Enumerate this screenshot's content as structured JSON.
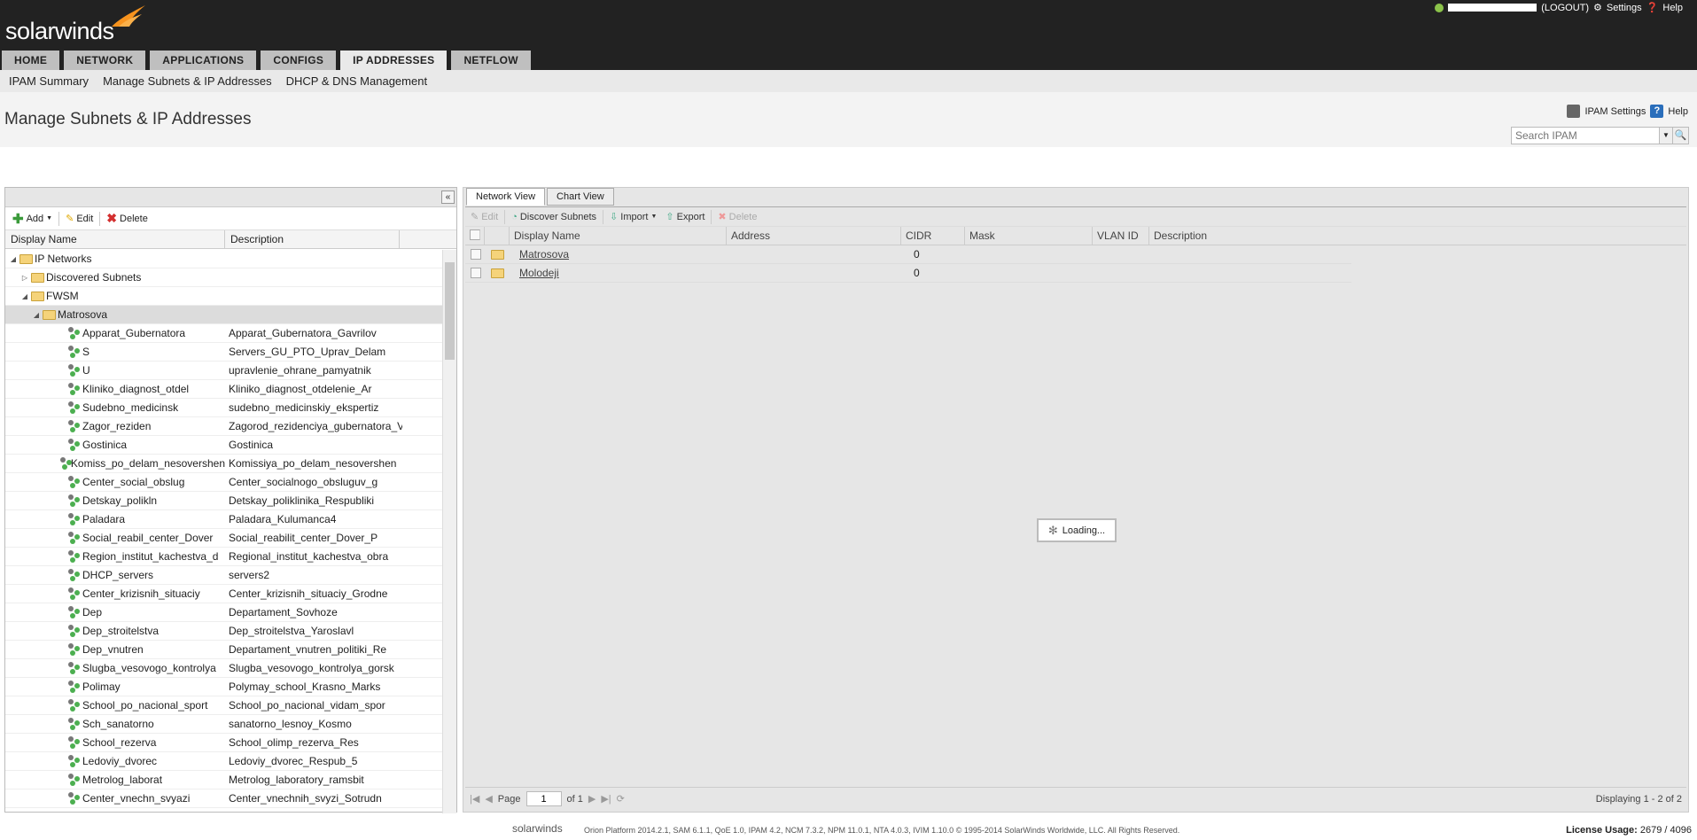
{
  "header": {
    "logo": "solarwinds",
    "logout": "(LOGOUT)",
    "settings": "Settings",
    "help": "Help",
    "colors": {
      "bg": "#222222",
      "flame": "#f7931e"
    }
  },
  "nav": {
    "tabs": [
      "HOME",
      "NETWORK",
      "APPLICATIONS",
      "CONFIGS",
      "IP ADDRESSES",
      "NETFLOW"
    ],
    "active": "IP ADDRESSES"
  },
  "subnav": [
    "IPAM Summary",
    "Manage Subnets & IP Addresses",
    "DHCP & DNS Management"
  ],
  "page": {
    "title": "Manage Subnets & IP Addresses",
    "ipam_settings": "IPAM Settings",
    "help": "Help",
    "search_placeholder": "Search IPAM"
  },
  "left": {
    "toolbar": {
      "add": "Add",
      "edit": "Edit",
      "delete": "Delete"
    },
    "columns": [
      "Display Name",
      "Description"
    ],
    "tree": [
      {
        "level": 0,
        "type": "folder",
        "name": "IP Networks",
        "desc": "",
        "expanded": true
      },
      {
        "level": 1,
        "type": "folder",
        "name": "Discovered Subnets",
        "desc": "",
        "expanded": false
      },
      {
        "level": 1,
        "type": "folder",
        "name": "FWSM",
        "desc": "",
        "expanded": true
      },
      {
        "level": 2,
        "type": "folder",
        "name": "Matrosova",
        "desc": "",
        "expanded": true,
        "selected": true
      },
      {
        "level": 3,
        "type": "subnet",
        "name": "Apparat_Gubernatora",
        "desc": "Apparat_Gubernatora_Gavrilov"
      },
      {
        "level": 3,
        "type": "subnet",
        "name": "S",
        "desc": "Servers_GU_PTO_Uprav_Delam"
      },
      {
        "level": 3,
        "type": "subnet",
        "name": "U",
        "desc": "upravlenie_ohrane_pamyatnik"
      },
      {
        "level": 3,
        "type": "subnet",
        "name": "Kliniko_diagnost_otdel",
        "desc": "Kliniko_diagnost_otdelenie_Ar"
      },
      {
        "level": 3,
        "type": "subnet",
        "name": "Sudebno_medicinsk",
        "desc": "sudebno_medicinskiy_ekspertiz"
      },
      {
        "level": 3,
        "type": "subnet",
        "name": "Zagor_reziden",
        "desc": "Zagorod_rezidenciya_gubernatora_V"
      },
      {
        "level": 3,
        "type": "subnet",
        "name": "Gostinica",
        "desc": "Gostinica"
      },
      {
        "level": 3,
        "type": "subnet",
        "name": "Komiss_po_delam_nesovershen",
        "desc": "Komissiya_po_delam_nesovershen"
      },
      {
        "level": 3,
        "type": "subnet",
        "name": "Center_social_obslug",
        "desc": "Center_socialnogo_obsluguv_g"
      },
      {
        "level": 3,
        "type": "subnet",
        "name": "Detskay_polikln",
        "desc": "Detskay_poliklinika_Respubliki"
      },
      {
        "level": 3,
        "type": "subnet",
        "name": "Paladara",
        "desc": "Paladara_Kulumanca4"
      },
      {
        "level": 3,
        "type": "subnet",
        "name": "Social_reabil_center_Dover",
        "desc": "Social_reabilit_center_Dover_P"
      },
      {
        "level": 3,
        "type": "subnet",
        "name": "Region_institut_kachestva_d",
        "desc": "Regional_institut_kachestva_obra"
      },
      {
        "level": 3,
        "type": "subnet",
        "name": "DHCP_servers",
        "desc": "servers2"
      },
      {
        "level": 3,
        "type": "subnet",
        "name": "Center_krizisnih_situaciy",
        "desc": "Center_krizisnih_situaciy_Grodne"
      },
      {
        "level": 3,
        "type": "subnet",
        "name": "Dep",
        "desc": "Departament_Sovhoze"
      },
      {
        "level": 3,
        "type": "subnet",
        "name": "Dep_stroitelstva",
        "desc": "Dep_stroitelstva_Yaroslavl"
      },
      {
        "level": 3,
        "type": "subnet",
        "name": "Dep_vnutren",
        "desc": "Departament_vnutren_politiki_Re"
      },
      {
        "level": 3,
        "type": "subnet",
        "name": "Slugba_vesovogo_kontrolya",
        "desc": "Slugba_vesovogo_kontrolya_gorsk"
      },
      {
        "level": 3,
        "type": "subnet",
        "name": "Polimay",
        "desc": "Polymay_school_Krasno_Marks"
      },
      {
        "level": 3,
        "type": "subnet",
        "name": "School_po_nacional_sport",
        "desc": "School_po_nacional_vidam_spor"
      },
      {
        "level": 3,
        "type": "subnet",
        "name": "Sch_sanatorno",
        "desc": "sanatorno_lesnoy_Kosmo"
      },
      {
        "level": 3,
        "type": "subnet",
        "name": "School_rezerva",
        "desc": "School_olimp_rezerva_Res"
      },
      {
        "level": 3,
        "type": "subnet",
        "name": "Ledoviy_dvorec",
        "desc": "Ledoviy_dvorec_Respub_5"
      },
      {
        "level": 3,
        "type": "subnet",
        "name": "Metrolog_laborat",
        "desc": "Metrolog_laboratory_ramsbit"
      },
      {
        "level": 3,
        "type": "subnet",
        "name": "Center_vnechn_svyazi",
        "desc": "Center_vnechnih_svyzi_Sotrudn"
      }
    ]
  },
  "right": {
    "tabs": [
      "Network View",
      "Chart View"
    ],
    "active_tab": "Network View",
    "toolbar": {
      "edit": "Edit",
      "discover": "Discover Subnets",
      "import": "Import",
      "export": "Export",
      "delete": "Delete"
    },
    "columns": [
      "Display Name",
      "Address",
      "CIDR",
      "Mask",
      "VLAN ID",
      "Description"
    ],
    "rows": [
      {
        "name": "Matrosova",
        "address": "",
        "cidr": "0",
        "mask": "",
        "vlan": "",
        "desc": ""
      },
      {
        "name": "Molodeji",
        "address": "",
        "cidr": "0",
        "mask": "",
        "vlan": "",
        "desc": ""
      }
    ],
    "loading": "Loading...",
    "pager": {
      "page_label": "Page",
      "page": "1",
      "of": "of 1",
      "displaying": "Displaying 1 - 2 of 2"
    }
  },
  "footer": {
    "logo": "solarwinds",
    "text": "Orion Platform 2014.2.1, SAM 6.1.1, QoE 1.0, IPAM 4.2, NCM 7.3.2, NPM 11.0.1, NTA 4.0.3, IVIM 1.10.0 © 1995-2014 SolarWinds Worldwide, LLC. All Rights Reserved.",
    "license_label": "License Usage:",
    "license_value": "2679 / 4096"
  }
}
